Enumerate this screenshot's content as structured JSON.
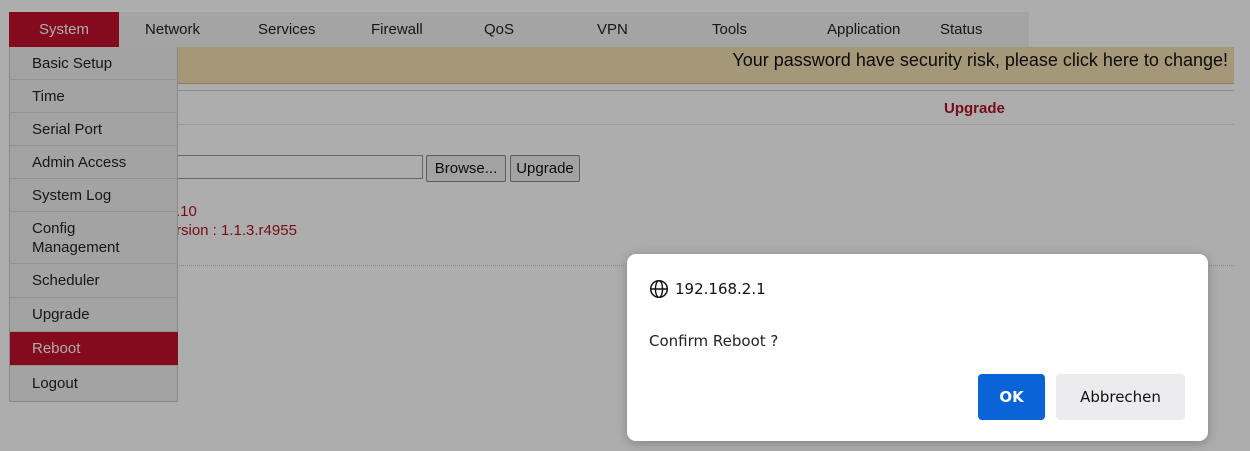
{
  "nav": {
    "items": [
      {
        "label": "System",
        "active": true
      },
      {
        "label": "Network"
      },
      {
        "label": "Services"
      },
      {
        "label": "Firewall"
      },
      {
        "label": "QoS"
      },
      {
        "label": "VPN"
      },
      {
        "label": "Tools"
      },
      {
        "label": "Application"
      },
      {
        "label": "Status"
      }
    ]
  },
  "warning": "Your password have security risk, please click here to change!",
  "main": {
    "title": "Upgrade",
    "browse_label": "Browse...",
    "upgrade_label": "Upgrade",
    "line1": ".10",
    "line2": "rsion : 1.1.3.r4955"
  },
  "sidebar": {
    "items": [
      {
        "label": "Basic Setup"
      },
      {
        "label": "Time"
      },
      {
        "label": "Serial Port"
      },
      {
        "label": "Admin Access"
      },
      {
        "label": "System Log"
      },
      {
        "label": "Config Management"
      },
      {
        "label": "Scheduler"
      },
      {
        "label": "Upgrade"
      },
      {
        "label": "Reboot",
        "active": true
      },
      {
        "label": "Logout"
      }
    ]
  },
  "dialog": {
    "host": "192.168.2.1",
    "message": "Confirm Reboot ?",
    "ok_label": "OK",
    "cancel_label": "Abbrechen"
  },
  "colors": {
    "accent": "#c1112c",
    "dialog_primary": "#0b63d8"
  }
}
